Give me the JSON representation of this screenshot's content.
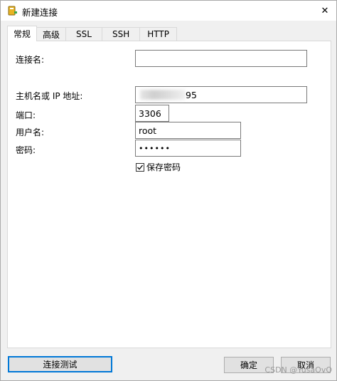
{
  "window": {
    "title": "新建连接",
    "close_glyph": "✕"
  },
  "tabs": [
    {
      "label": "常规",
      "active": true
    },
    {
      "label": "高级",
      "active": false
    },
    {
      "label": "SSL",
      "active": false
    },
    {
      "label": "SSH",
      "active": false
    },
    {
      "label": "HTTP",
      "active": false
    }
  ],
  "form": {
    "connection_name": {
      "label": "连接名:",
      "value": ""
    },
    "host": {
      "label": "主机名或 IP 地址:",
      "value_visible_suffix": "95"
    },
    "port": {
      "label": "端口:",
      "value": "3306"
    },
    "username": {
      "label": "用户名:",
      "value": "root"
    },
    "password": {
      "label": "密码:",
      "value": "••••••"
    },
    "save_password": {
      "label": "保存密码",
      "checked": true
    }
  },
  "buttons": {
    "test_connection": "连接测试",
    "ok": "确定",
    "cancel": "取消"
  },
  "watermark": "CSDN @YusaOvO",
  "colors": {
    "accent": "#0078d7",
    "app_icon": "#d4a017"
  },
  "icons": {
    "app": "database-plug-icon",
    "close": "close-icon",
    "check": "checkmark-icon"
  }
}
